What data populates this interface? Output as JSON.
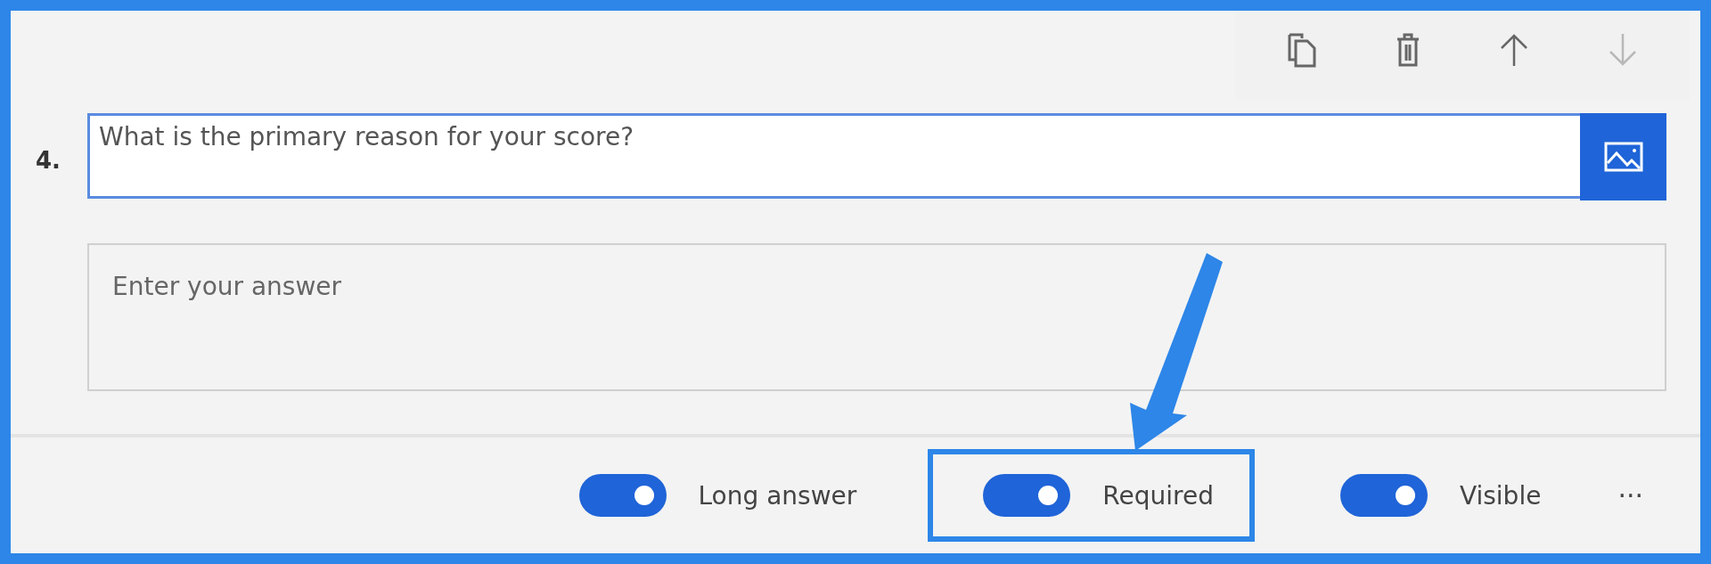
{
  "toolbar": {
    "buttons": [
      {
        "kind": "copy",
        "disabled": false
      },
      {
        "kind": "delete",
        "disabled": false
      },
      {
        "kind": "up",
        "disabled": false
      },
      {
        "kind": "down",
        "disabled": true
      }
    ]
  },
  "question": {
    "number": "4.",
    "value": "What is the primary reason for your score?",
    "answer": {
      "placeholder": "Enter your answer"
    }
  },
  "options": [
    {
      "label": "Long answer",
      "on": true,
      "highlighted": false
    },
    {
      "label": "Required",
      "on": true,
      "highlighted": true
    },
    {
      "label": "Visible",
      "on": true,
      "highlighted": false
    }
  ],
  "more": "···"
}
